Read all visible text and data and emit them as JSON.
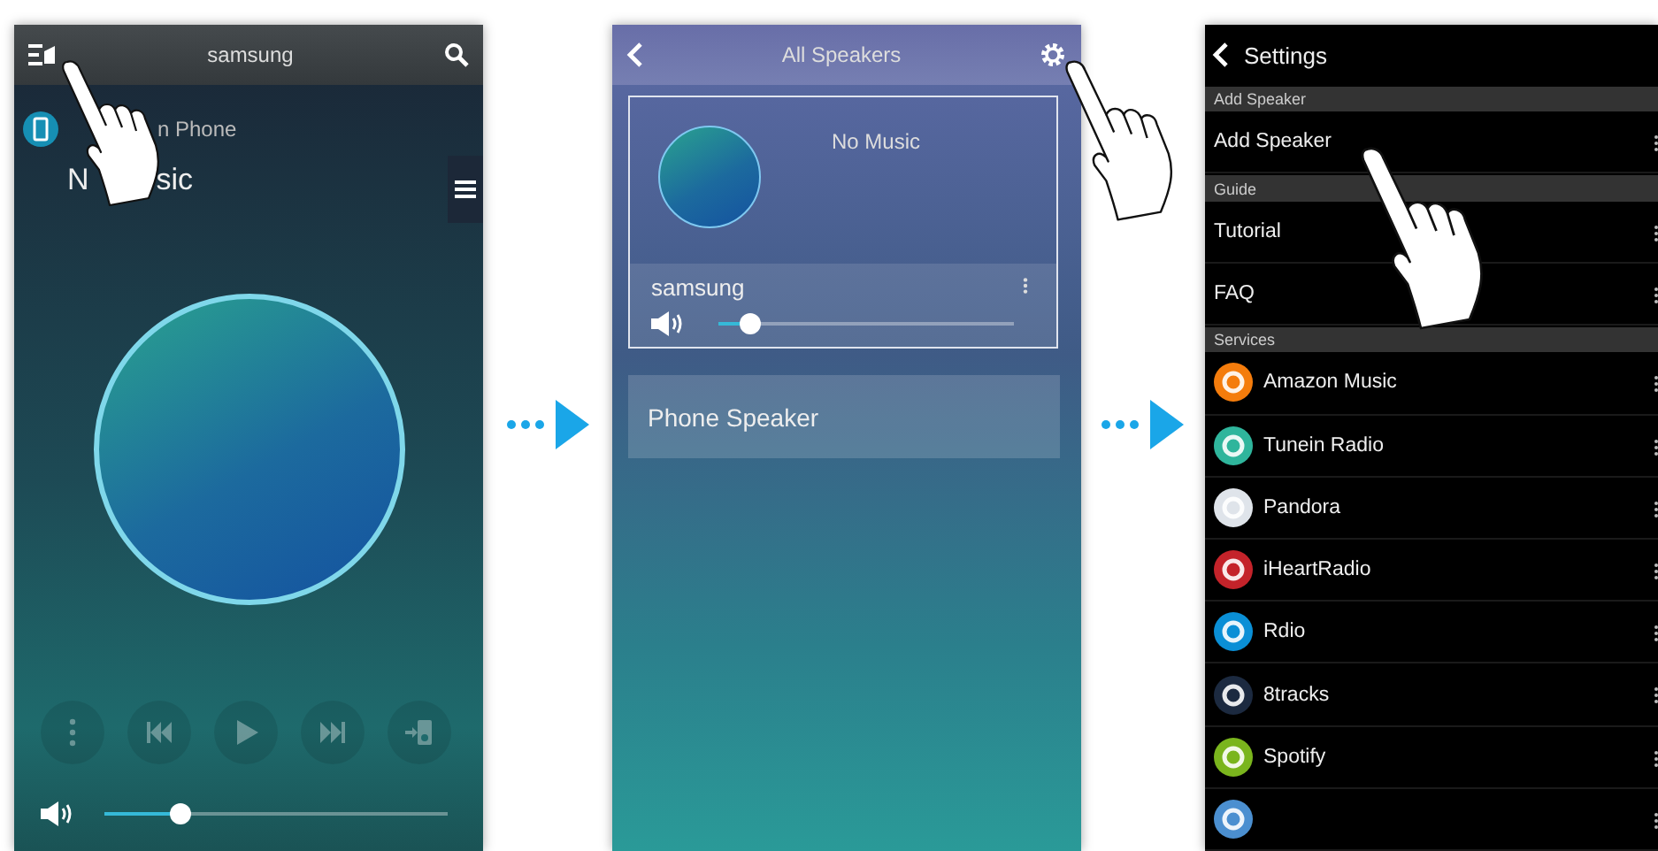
{
  "player_screen": {
    "header": {
      "title": "samsung"
    },
    "source": "n Phone",
    "now_playing": [
      "N",
      "sic"
    ],
    "volume": {
      "level": 0.22
    }
  },
  "speakers_screen": {
    "header": {
      "title": "All Speakers"
    },
    "group": {
      "now_playing": "No Music",
      "speaker": "samsung",
      "volume": {
        "level": 0.11
      }
    },
    "other_speaker": "Phone Speaker"
  },
  "settings_screen": {
    "header": {
      "title": "Settings"
    },
    "sections": [
      {
        "title": "Add Speaker",
        "items": [
          {
            "label": "Add Speaker"
          }
        ]
      },
      {
        "title": "Guide",
        "items": [
          {
            "label": "Tutorial"
          },
          {
            "label": "FAQ"
          }
        ]
      },
      {
        "title": "Services",
        "items": [
          {
            "label": "Amazon Music",
            "color": "#f47c0c"
          },
          {
            "label": "Tunein Radio",
            "color": "#2fb59c"
          },
          {
            "label": "Pandora",
            "color": "#dfe4ea"
          },
          {
            "label": "iHeartRadio",
            "color": "#c4232a"
          },
          {
            "label": "Rdio",
            "color": "#0a8fd6"
          },
          {
            "label": "8tracks",
            "color": "#1c2a40"
          },
          {
            "label": "Spotify",
            "color": "#7ab51d"
          },
          {
            "color": "#4b8fd0"
          }
        ]
      }
    ]
  }
}
